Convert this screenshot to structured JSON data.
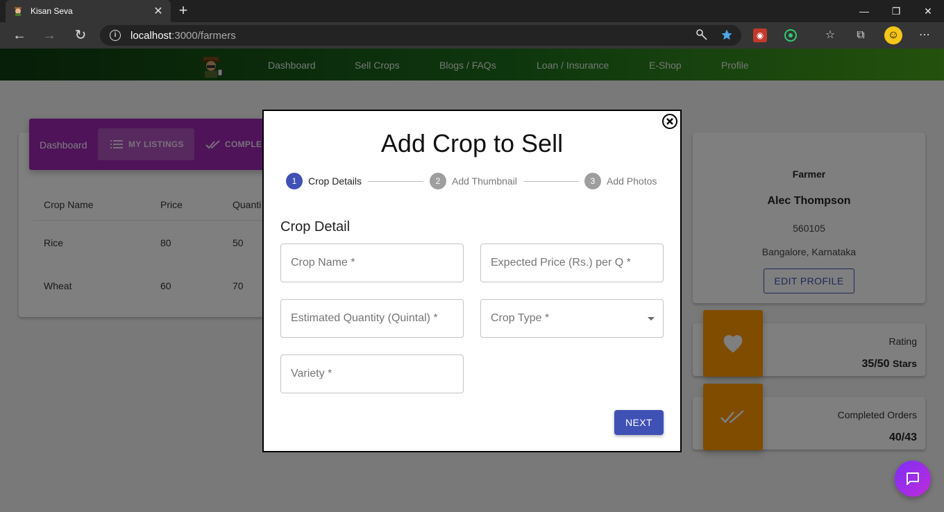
{
  "browser": {
    "tab_title": "Kisan Seva",
    "url_host": "localhost",
    "url_path": ":3000/farmers"
  },
  "nav": {
    "items": [
      "Dashboard",
      "Sell Crops",
      "Blogs / FAQs",
      "Loan / Insurance",
      "E-Shop",
      "Profile"
    ]
  },
  "dashboard": {
    "label": "Dashboard",
    "tabs": [
      "MY LISTINGS",
      "COMPLE"
    ],
    "table": {
      "headers": [
        "Crop Name",
        "Price",
        "Quanti"
      ],
      "rows": [
        [
          "Rice",
          "80",
          "50"
        ],
        [
          "Wheat",
          "60",
          "70"
        ]
      ]
    }
  },
  "profile": {
    "role": "Farmer",
    "name": "Alec Thompson",
    "pincode": "560105",
    "location": "Bangalore, Karnataka",
    "edit_label": "EDIT PROFILE"
  },
  "stats": {
    "rating_label": "Rating",
    "rating_value": "35/50",
    "rating_unit": "Stars",
    "orders_label": "Completed Orders",
    "orders_value": "40/43"
  },
  "modal": {
    "title": "Add Crop to Sell",
    "steps": [
      {
        "num": "1",
        "label": "Crop Details"
      },
      {
        "num": "2",
        "label": "Add Thumbnail"
      },
      {
        "num": "3",
        "label": "Add Photos"
      }
    ],
    "section_title": "Crop Detail",
    "fields": {
      "crop_name": "Crop Name *",
      "expected_price": "Expected Price (Rs.) per Q *",
      "estimated_quantity": "Estimated Quantity (Quintal) *",
      "crop_type": "Crop Type *",
      "variety": "Variety *"
    },
    "next_label": "NEXT"
  },
  "colors": {
    "accent": "#3f51b5",
    "tabbar": "#9c27b0",
    "stat_icon": "#ff9800",
    "appbar_start": "#0e3c10",
    "appbar_end": "#4aa21b"
  }
}
